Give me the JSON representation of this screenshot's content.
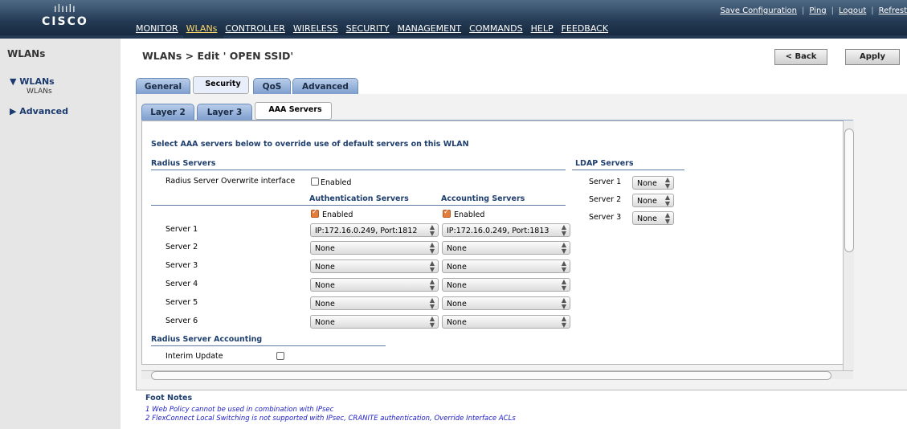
{
  "header": {
    "logo_bars": "ılıılı",
    "logo_word": "CISCO",
    "menu": [
      "MONITOR",
      "WLANs",
      "CONTROLLER",
      "WIRELESS",
      "SECURITY",
      "MANAGEMENT",
      "COMMANDS",
      "HELP",
      "FEEDBACK"
    ],
    "active_menu": "WLANs",
    "links": {
      "save": "Save Configuration",
      "ping": "Ping",
      "logout": "Logout",
      "refresh": "Refrest"
    }
  },
  "sidebar": {
    "title": "WLANs",
    "wlans": "WLANs",
    "wlans_sub": "WLANs",
    "advanced": "Advanced"
  },
  "page": {
    "title": "WLANs > Edit  ' OPEN SSID'",
    "back": "< Back",
    "apply": "Apply"
  },
  "tabs": {
    "general": "General",
    "security": "Security",
    "qos": "QoS",
    "advanced": "Advanced"
  },
  "subtabs": {
    "layer2": "Layer 2",
    "layer3": "Layer 3",
    "aaa": "AAA Servers"
  },
  "aaa": {
    "intro": "Select AAA servers below to override use of default servers on this WLAN",
    "radius_title": "Radius Servers",
    "overwrite_label": "Radius Server Overwrite interface",
    "overwrite_enabled_label": "Enabled",
    "auth_header": "Authentication Servers",
    "acct_header": "Accounting Servers",
    "auth_enabled": "Enabled",
    "acct_enabled": "Enabled",
    "servers": [
      {
        "label": "Server 1",
        "auth": "IP:172.16.0.249, Port:1812",
        "acct": "IP:172.16.0.249, Port:1813"
      },
      {
        "label": "Server 2",
        "auth": "None",
        "acct": "None"
      },
      {
        "label": "Server 3",
        "auth": "None",
        "acct": "None"
      },
      {
        "label": "Server 4",
        "auth": "None",
        "acct": "None"
      },
      {
        "label": "Server 5",
        "auth": "None",
        "acct": "None"
      },
      {
        "label": "Server 6",
        "auth": "None",
        "acct": "None"
      }
    ],
    "accounting_title": "Radius Server Accounting",
    "interim_label": "Interim Update",
    "ldap_title": "LDAP Servers",
    "ldap": [
      {
        "label": "Server 1",
        "value": "None"
      },
      {
        "label": "Server 2",
        "value": "None"
      },
      {
        "label": "Server 3",
        "value": "None"
      }
    ]
  },
  "footnotes": {
    "title": "Foot Notes",
    "items": [
      "1 Web Policy cannot be used in combination with IPsec",
      "2 FlexConnect Local Switching is not supported with IPsec, CRANITE authentication, Override Interface ACLs"
    ]
  }
}
